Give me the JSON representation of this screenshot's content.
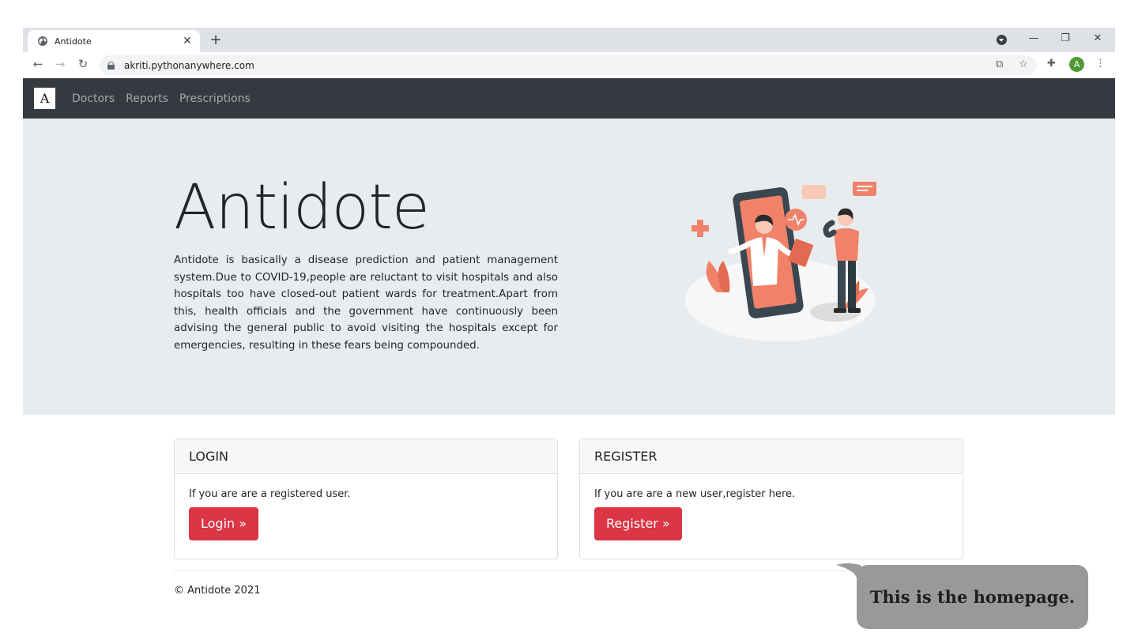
{
  "browser": {
    "tab_title": "Antidote",
    "tab_close": "✕",
    "new_tab": "+",
    "url": "akriti.pythonanywhere.com",
    "avatar_letter": "A",
    "icons": {
      "back": "arrow-left-icon",
      "forward": "arrow-right-icon",
      "reload": "reload-icon",
      "translate": "translate-icon",
      "bookmark": "star-icon",
      "extensions": "puzzle-icon",
      "menu": "kebab-menu-icon"
    }
  },
  "navbar": {
    "brand_letter": "A",
    "links": [
      "Doctors",
      "Reports",
      "Prescriptions"
    ]
  },
  "hero": {
    "title": "Antidote",
    "description": "Antidote is basically a disease prediction and patient management system.Due to COVID-19,people are reluctant to visit hospitals and also hospitals too have closed-out patient wards for treatment.Apart from this, health officials and the government have continuously been advising the general public to avoid visiting the hospitals except for emergencies, resulting in these fears being compounded."
  },
  "login_card": {
    "header": "LOGIN",
    "text": "If you are are a registered user.",
    "button": "Login »"
  },
  "register_card": {
    "header": "REGISTER",
    "text": "If you are are a new user,register here.",
    "button": "Register »"
  },
  "footer": {
    "copyright": "© Antidote 2021"
  },
  "caption": {
    "text": "This is the homepage."
  },
  "colors": {
    "navbar_bg": "#343a40",
    "hero_bg": "#e9ecef",
    "button_danger": "#dc3545",
    "illustration_accent": "#f0826a"
  }
}
